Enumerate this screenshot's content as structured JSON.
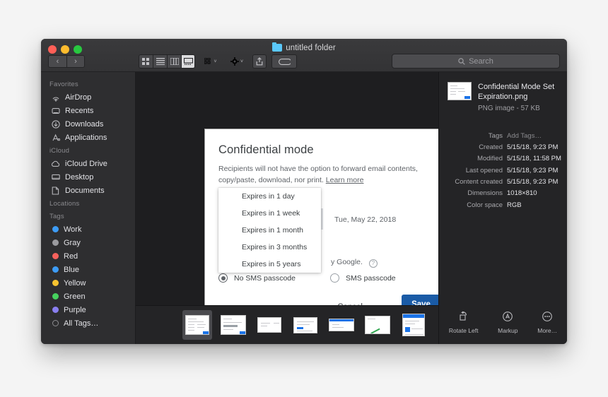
{
  "window": {
    "title": "untitled folder",
    "folder_icon": "folder-icon",
    "nav_back": "‹",
    "nav_forward": "›"
  },
  "toolbar": {
    "view_icon_label": "icon-view-icon",
    "view_list_label": "list-view-icon",
    "view_column_label": "column-view-icon",
    "view_gallery_label": "gallery-view-icon",
    "group_label": "group-by-icon",
    "action_label": "action-gear-icon",
    "share_label": "share-icon",
    "tag_label": "tag-icon",
    "chevron": "˅"
  },
  "search": {
    "placeholder": "Search",
    "icon": "search-icon"
  },
  "sidebar": {
    "sections": [
      {
        "header": "Favorites",
        "items": [
          {
            "label": "AirDrop",
            "icon": "airdrop-icon"
          },
          {
            "label": "Recents",
            "icon": "clock-icon"
          },
          {
            "label": "Downloads",
            "icon": "download-icon"
          },
          {
            "label": "Applications",
            "icon": "applications-icon"
          }
        ]
      },
      {
        "header": "iCloud",
        "items": [
          {
            "label": "iCloud Drive",
            "icon": "cloud-icon"
          },
          {
            "label": "Desktop",
            "icon": "desktop-icon"
          },
          {
            "label": "Documents",
            "icon": "documents-icon"
          }
        ]
      },
      {
        "header": "Locations",
        "items": []
      },
      {
        "header": "Tags",
        "items": [
          {
            "label": "Work",
            "icon": "tag-dot-icon",
            "color": "#3d9cf5"
          },
          {
            "label": "Gray",
            "icon": "tag-dot-icon",
            "color": "#9b9b9f"
          },
          {
            "label": "Red",
            "icon": "tag-dot-icon",
            "color": "#f5615c"
          },
          {
            "label": "Blue",
            "icon": "tag-dot-icon",
            "color": "#3d9cf5"
          },
          {
            "label": "Yellow",
            "icon": "tag-dot-icon",
            "color": "#f5c330"
          },
          {
            "label": "Green",
            "icon": "tag-dot-icon",
            "color": "#46d15e"
          },
          {
            "label": "Purple",
            "icon": "tag-dot-icon",
            "color": "#8a7ff0"
          },
          {
            "label": "All Tags…",
            "icon": "all-tags-icon",
            "color": ""
          }
        ]
      }
    ]
  },
  "dialog": {
    "title": "Confidential mode",
    "description": "Recipients will not have the option to forward email contents, copy/paste, download, nor print.",
    "learn_more": "Learn more",
    "expiry_date": "Tue, May 22, 2018",
    "google_note": "y Google.",
    "help_icon": "?",
    "radio_no_sms": "No SMS passcode",
    "radio_sms": "SMS passcode",
    "cancel_label": "Cancel",
    "save_label": "Save",
    "save_color": "#1a5ba6",
    "dropdown_options": [
      "Expires in 1 day",
      "Expires in 1 week",
      "Expires in 1 month",
      "Expires in 3 months",
      "Expires in 5 years"
    ]
  },
  "filmstrip": {
    "count": 7,
    "selected_index": 0
  },
  "info": {
    "file_name": "Confidential Mode Set Expiration.png",
    "file_meta": "PNG image - 57 KB",
    "metadata": [
      {
        "key": "Tags",
        "value": "Add Tags…",
        "muted": true
      },
      {
        "key": "Created",
        "value": "5/15/18, 9:23 PM",
        "muted": false
      },
      {
        "key": "Modified",
        "value": "5/15/18, 11:58 PM",
        "muted": false
      },
      {
        "key": "Last opened",
        "value": "5/15/18, 9:23 PM",
        "muted": false
      },
      {
        "key": "Content created",
        "value": "5/15/18, 9:23 PM",
        "muted": false
      },
      {
        "key": "Dimensions",
        "value": "1018×810",
        "muted": false
      },
      {
        "key": "Color space",
        "value": "RGB",
        "muted": false
      }
    ],
    "actions": [
      {
        "label": "Rotate Left",
        "icon": "rotate-left-icon"
      },
      {
        "label": "Markup",
        "icon": "markup-icon"
      },
      {
        "label": "More…",
        "icon": "more-icon"
      }
    ]
  }
}
